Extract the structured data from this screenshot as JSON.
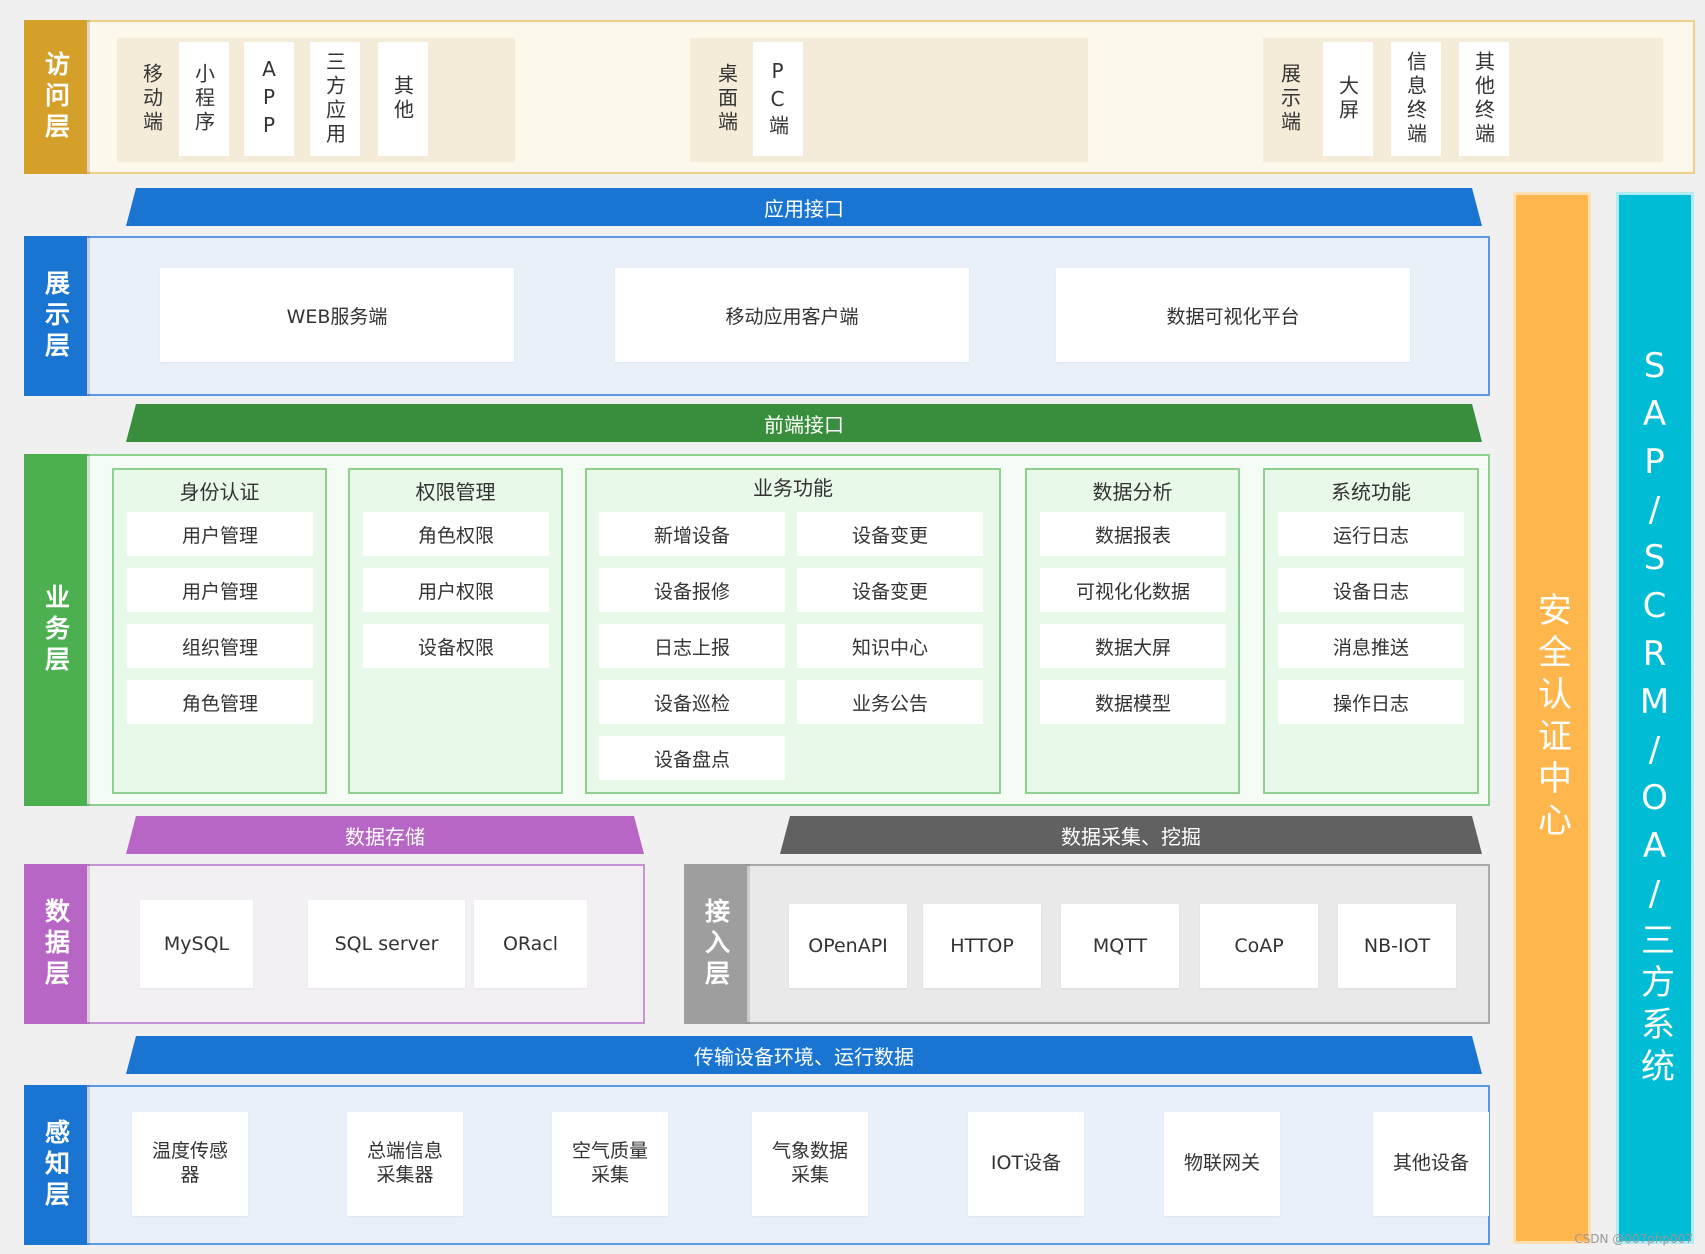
{
  "access_layer": {
    "label": "访问层",
    "group1": [
      "移动端",
      "小程序",
      "APP",
      "三方应用",
      "其他"
    ],
    "group2": [
      "桌面端",
      "PC端"
    ],
    "group3": [
      "展示端",
      "大屏",
      "信息终端",
      "其他终端"
    ]
  },
  "app_interface": "应用接口",
  "display_layer": {
    "label": "展示层",
    "items": [
      "WEB服务端",
      "移动应用客户端",
      "数据可视化平台"
    ]
  },
  "frontend_interface": "前端接口",
  "business_layer": {
    "label": "业务层",
    "identity": {
      "title": "身份认证",
      "items": [
        "用户管理",
        "用户管理",
        "组织管理",
        "角色管理"
      ]
    },
    "permission": {
      "title": "权限管理",
      "items": [
        "角色权限",
        "用户权限",
        "设备权限"
      ]
    },
    "business": {
      "title": "业务功能",
      "left": [
        "新增设备",
        "设备报修",
        "日志上报",
        "设备巡检",
        "设备盘点"
      ],
      "right": [
        "设备变更",
        "设备变更",
        "知识中心",
        "业务公告"
      ]
    },
    "analysis": {
      "title": "数据分析",
      "items": [
        "数据报表",
        "可视化化数据",
        "数据大屏",
        "数据模型"
      ]
    },
    "system": {
      "title": "系统功能",
      "items": [
        "运行日志",
        "设备日志",
        "消息推送",
        "操作日志"
      ]
    }
  },
  "data_storage": "数据存储",
  "data_collect": "数据采集、挖掘",
  "data_layer": {
    "label": "数据层",
    "items": [
      "MySQL",
      "SQL server",
      "ORacl"
    ]
  },
  "access_in_layer": {
    "label": "接入层",
    "items": [
      "OPenAPI",
      "HTTOP",
      "MQTT",
      "CoAP",
      "NB-IOT"
    ]
  },
  "transmission": "传输设备环境、运行数据",
  "perception_layer": {
    "label": "感知层",
    "items": [
      "温度传感器",
      "总端信息采集器",
      "空气质量采集",
      "气象数据采集",
      "IOT设备",
      "物联网关",
      "其他设备"
    ]
  },
  "security_center": "安全认证中心",
  "third_party": "SAP/SCRM/OA/三方系统",
  "watermark": "CSDN @007php007",
  "colors": {
    "access": "#d4a02a",
    "display": "#1a75d2",
    "business": "#4caf50",
    "green_banner": "#388e3c",
    "data": "#b866c6",
    "access_in": "#9e9e9e",
    "collect_banner": "#616161",
    "security": "#ffb74d",
    "third": "#00bcd4"
  }
}
